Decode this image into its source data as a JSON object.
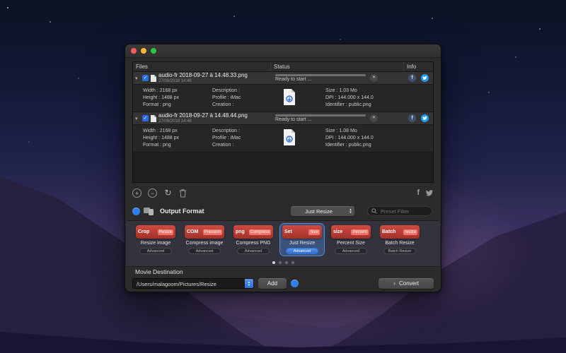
{
  "icons": {
    "disclosure": "▾",
    "check": "✓",
    "close": "✕",
    "plus": "+",
    "minus": "−",
    "refresh": "↻",
    "facebook": "f",
    "popup_up": "▲",
    "popup_down": "▼",
    "stepper_up": "▲",
    "stepper_down": "▼",
    "chevron_right": "›"
  },
  "window": {
    "columns": {
      "files": "Files",
      "status": "Status",
      "info": "Info"
    },
    "files": [
      {
        "name": "audio-fr 2018-09-27 à 14.48.33.png",
        "date": "27/09/2018 14:48",
        "status": "Ready to start ...",
        "width": "Width : 2168 px",
        "height": "Height : 1488 px",
        "format": "Format : png",
        "description": "Description :",
        "profile": "Profile : iMac",
        "creation": "Creation :",
        "size": "Size : 1.03 Mo",
        "dpi": "DPI : 144.000 x 144.0",
        "identifier": "Identifier : public.png"
      },
      {
        "name": "audio-fr 2018-09-27 à 14.48.44.png",
        "date": "27/09/2018 14:48",
        "status": "Ready to start ...",
        "width": "Width : 2168 px",
        "height": "Height : 1488 px",
        "format": "Format : png",
        "description": "Description :",
        "profile": "Profile : iMac",
        "creation": "Creation :",
        "size": "Size : 1.08 Mo",
        "dpi": "DPI : 144.000 x 144.0",
        "identifier": "Identifier : public.png"
      }
    ],
    "output_format": {
      "label": "Output Format",
      "popup_value": "Just Resize",
      "filter_placeholder": "Preset Filter"
    },
    "presets": [
      {
        "tag": "Crop",
        "tag2": "Resize",
        "caption": "Resize image",
        "action": "Advanced"
      },
      {
        "tag": "COM",
        "tag2": "Pression",
        "caption": "Compress image",
        "action": "Advanced"
      },
      {
        "tag": "png",
        "tag2": "Compress",
        "caption": "Compress PNG",
        "action": "Advanced"
      },
      {
        "tag": "Set",
        "tag2": "Size",
        "caption": "Just Resize",
        "action": "Advanced"
      },
      {
        "tag": "size",
        "tag2": "Percent",
        "caption": "Percent Size",
        "action": "Advanced"
      },
      {
        "tag": "Batch",
        "tag2": "resize",
        "caption": "Batch Resize",
        "action": "Batch Resize"
      }
    ],
    "destination": {
      "label": "Movie Destination",
      "path": "/Users/malagoom/Pictures/Resize",
      "add_label": "Add",
      "convert_label": "Convert"
    }
  }
}
